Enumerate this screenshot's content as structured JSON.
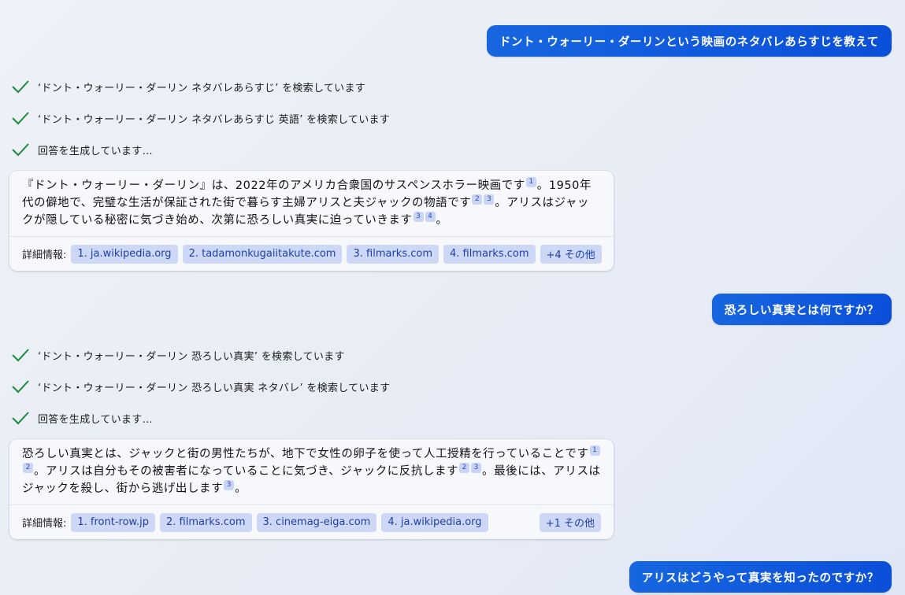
{
  "conversation": {
    "user_messages": [
      "ドント・ウォーリー・ダーリンという映画のネタバレあらすじを教えて",
      "恐ろしい真実とは何ですか？",
      "アリスはどうやって真実を知ったのですか？"
    ],
    "responses": [
      {
        "steps": [
          "‘ドント・ウォーリー・ダーリン ネタバレあらすじ’ を検索しています",
          "‘ドント・ウォーリー・ダーリン ネタバレあらすじ 英語’ を検索しています",
          "回答を生成しています…"
        ],
        "answer": {
          "seg1": "『ドント・ウォーリー・ダーリン』は、2022年のアメリカ合衆国のサスペンスホラー映画です",
          "cite1": "1",
          "seg2": "。1950年代の僻地で、完璧な生活が保証された街で暮らす主婦アリスと夫ジャックの物語です",
          "cite2": "2",
          "cite3": "3",
          "seg3": "。アリスはジャックが隠している秘密に気づき始め、次第に恐ろしい真実に迫っていきます",
          "cite4": "3",
          "cite5": "4",
          "seg4": "。"
        },
        "sources_label": "詳細情報:",
        "sources": [
          "1. ja.wikipedia.org",
          "2. tadamonkugaiitakute.com",
          "3. filmarks.com",
          "4. filmarks.com"
        ],
        "more": "+4 その他"
      },
      {
        "steps": [
          "‘ドント・ウォーリー・ダーリン 恐ろしい真実’ を検索しています",
          "‘ドント・ウォーリー・ダーリン 恐ろしい真実 ネタバレ’ を検索しています",
          "回答を生成しています…"
        ],
        "answer": {
          "seg1": "恐ろしい真実とは、ジャックと街の男性たちが、地下で女性の卵子を使って人工授精を行っていることです",
          "cite1": "1",
          "cite2": "2",
          "seg2": "。アリスは自分もその被害者になっていることに気づき、ジャックに反抗します",
          "cite3": "2",
          "cite4": "3",
          "seg3": "。最後には、アリスはジャックを殺し、街から逃げ出します",
          "cite5": "3",
          "seg4": "。"
        },
        "sources_label": "詳細情報:",
        "sources": [
          "1. front-row.jp",
          "2. filmarks.com",
          "3. cinemag-eiga.com",
          "4. ja.wikipedia.org"
        ],
        "more": "+1 その他"
      }
    ]
  },
  "colors": {
    "user_bubble": "#0b57d9",
    "check": "#1a8a3a",
    "chip_bg": "#cdd8f7",
    "chip_text": "#1e3fa6",
    "card_bg": "#f6f8fc"
  }
}
